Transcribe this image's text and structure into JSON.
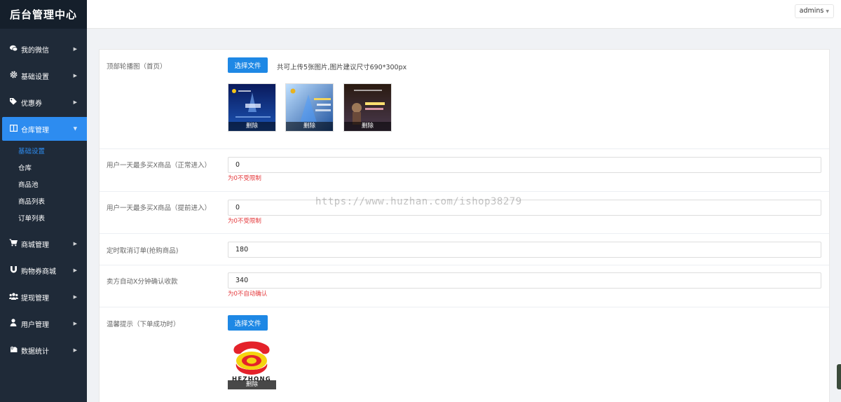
{
  "brand": "后台管理中心",
  "user": {
    "name": "admins"
  },
  "menu": {
    "items": [
      {
        "label": "我的微信",
        "icon": "chat-icon"
      },
      {
        "label": "基础设置",
        "icon": "gear-icon"
      },
      {
        "label": "优惠券",
        "icon": "tag-icon"
      },
      {
        "label": "仓库管理",
        "icon": "columns-icon"
      },
      {
        "label": "商城管理",
        "icon": "cart-icon"
      },
      {
        "label": "购物券商城",
        "icon": "magnet-icon"
      },
      {
        "label": "提现管理",
        "icon": "users-icon"
      },
      {
        "label": "用户管理",
        "icon": "user-icon"
      },
      {
        "label": "数据统计",
        "icon": "bookmark-icon"
      }
    ],
    "sub": [
      "基础设置",
      "仓库",
      "商品池",
      "商品列表",
      "订单列表"
    ]
  },
  "form": {
    "banner": {
      "label": "顶部轮播图（首页）",
      "button": "选择文件",
      "hint": "共可上传5张图片,图片建议尺寸690*300px",
      "delete_label": "删除"
    },
    "limit_normal": {
      "label": "用户一天最多买X商品（正常进入）",
      "value": "0",
      "note": "为0不受限制"
    },
    "limit_early": {
      "label": "用户一天最多买X商品（提前进入）",
      "value": "0",
      "note": "为0不受限制"
    },
    "cancel_timer": {
      "label": "定时取消订单(抢购商品)",
      "value": "180"
    },
    "auto_confirm": {
      "label": "卖方自动X分钟确认收款",
      "value": "340",
      "note": "为0不自动确认"
    },
    "tip": {
      "label": "温馨提示（下单成功时）",
      "button": "选择文件",
      "logo_text": "HEZHONG",
      "delete_label": "删除"
    }
  },
  "watermark": "https://www.huzhan.com/ishop38279",
  "colors": {
    "sidebar": "#1f2a38",
    "accent": "#2d8cf0",
    "button": "#1e88e5",
    "error": "#e4393c"
  }
}
